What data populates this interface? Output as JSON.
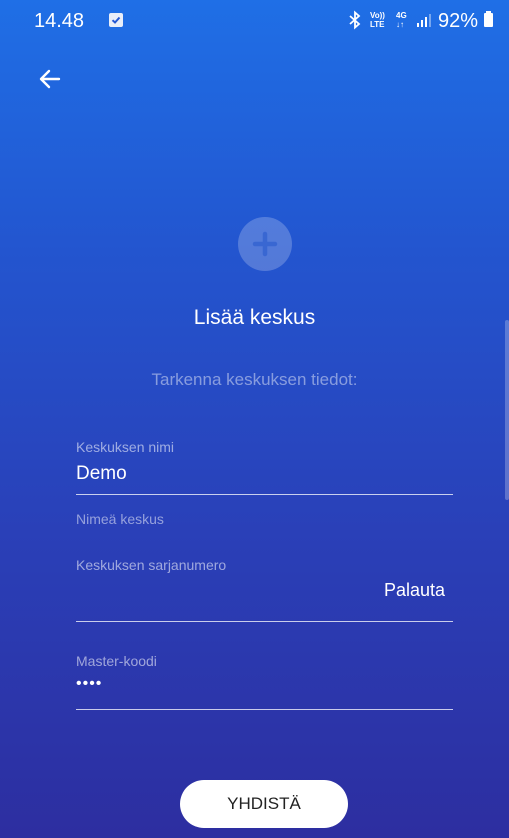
{
  "status_bar": {
    "time": "14.48",
    "volte_line1": "Vo))",
    "volte_line2": "LTE",
    "network_line1": "4G",
    "network_line2": "↓↑",
    "battery": "92%",
    "icons": [
      "checkbox-notification-icon",
      "bluetooth-icon",
      "volte-icon",
      "4g-icon",
      "signal-icon",
      "battery-icon"
    ]
  },
  "header": {
    "back_icon": "arrow-left-icon"
  },
  "main": {
    "add_icon": "plus-circle-icon",
    "title": "Lisää keskus",
    "subtitle": "Tarkenna keskuksen tiedot:",
    "fields": [
      {
        "label": "Keskuksen nimi",
        "value": "Demo",
        "helper": "Nimeä keskus"
      },
      {
        "label": "Keskuksen sarjanumero",
        "value": "",
        "action": "Palauta"
      },
      {
        "label": "Master-koodi",
        "value": "••••"
      }
    ],
    "connect_button": "YHDISTÄ"
  },
  "colors": {
    "gradient_top": "#1f6fe6",
    "gradient_bottom": "#2d2ea0",
    "button_bg": "#ffffff",
    "button_text": "#222222"
  }
}
